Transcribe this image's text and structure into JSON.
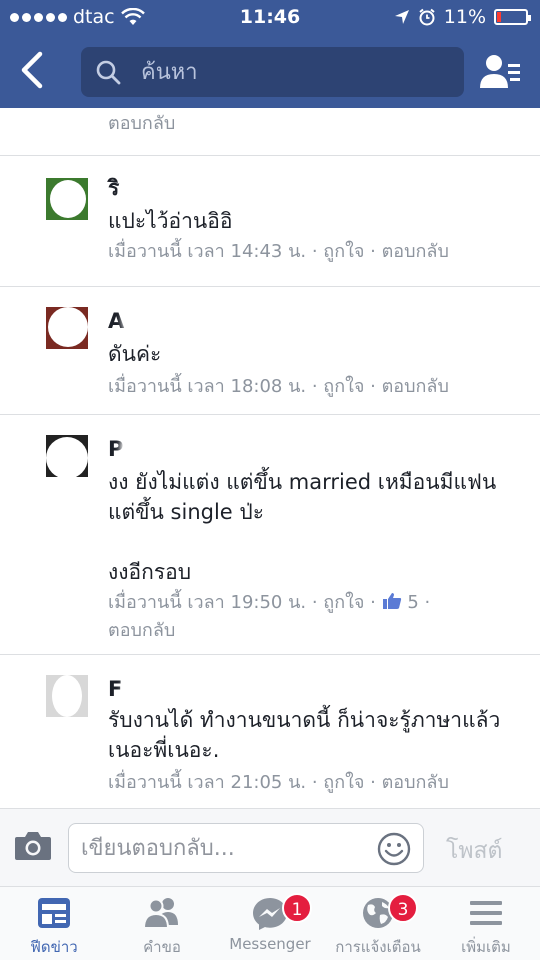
{
  "status_bar": {
    "carrier": "dtac",
    "time": "11:46",
    "battery": "11%",
    "battery_level": 0.11
  },
  "header": {
    "search_placeholder": "ค้นหา"
  },
  "comments": [
    {
      "name": "",
      "text": "",
      "meta_time": "",
      "like_label": "",
      "reply_label": "ตอบกลับ"
    },
    {
      "name": "ริ",
      "text": "แปะไว้อ่านอิอิ",
      "meta_time": "เมื่อวานนี้ เวลา 14:43 น.",
      "like_label": "ถูกใจ",
      "reply_label": "ตอบกลับ"
    },
    {
      "name": "A",
      "text": "ดันค่ะ",
      "meta_time": "เมื่อวานนี้ เวลา 18:08 น.",
      "like_label": "ถูกใจ",
      "reply_label": "ตอบกลับ"
    },
    {
      "name": "P",
      "text": "งง ยังไม่แต่ง แต่ขึ้น married เหมือนมีแฟน แต่ขึ้น single ป่ะ\n\nงงอีกรอบ",
      "meta_time": "เมื่อวานนี้ เวลา 19:50 น.",
      "like_label": "ถูกใจ",
      "like_count": "5",
      "reply_label": "ตอบกลับ"
    },
    {
      "name": "F",
      "text": "รับงานได้ ทำงานขนาดนี้ ก็น่าจะรู้ภาษาแล้ว เนอะพี่เนอะ.",
      "meta_time": "เมื่อวานนี้ เวลา 21:05 น.",
      "like_label": "ถูกใจ",
      "reply_label": "ตอบกลับ"
    }
  ],
  "reply_bar": {
    "placeholder": "เขียนตอบกลับ...",
    "post_label": "โพสต์"
  },
  "tabs": [
    {
      "label": "ฟีดข่าว",
      "icon": "news-feed-icon",
      "active": true
    },
    {
      "label": "คำขอ",
      "icon": "friend-requests-icon"
    },
    {
      "label": "Messenger",
      "icon": "messenger-icon",
      "badge": "1"
    },
    {
      "label": "การแจ้งเตือน",
      "icon": "notifications-globe-icon",
      "badge": "3"
    },
    {
      "label": "เพิ่มเติม",
      "icon": "menu-icon"
    }
  ],
  "colors": {
    "brand_blue": "#3b5998",
    "search_bg": "#2d4373",
    "badge_red": "#e41e3f",
    "meta_gray": "#8d949e",
    "active_tab": "#4267b2"
  }
}
